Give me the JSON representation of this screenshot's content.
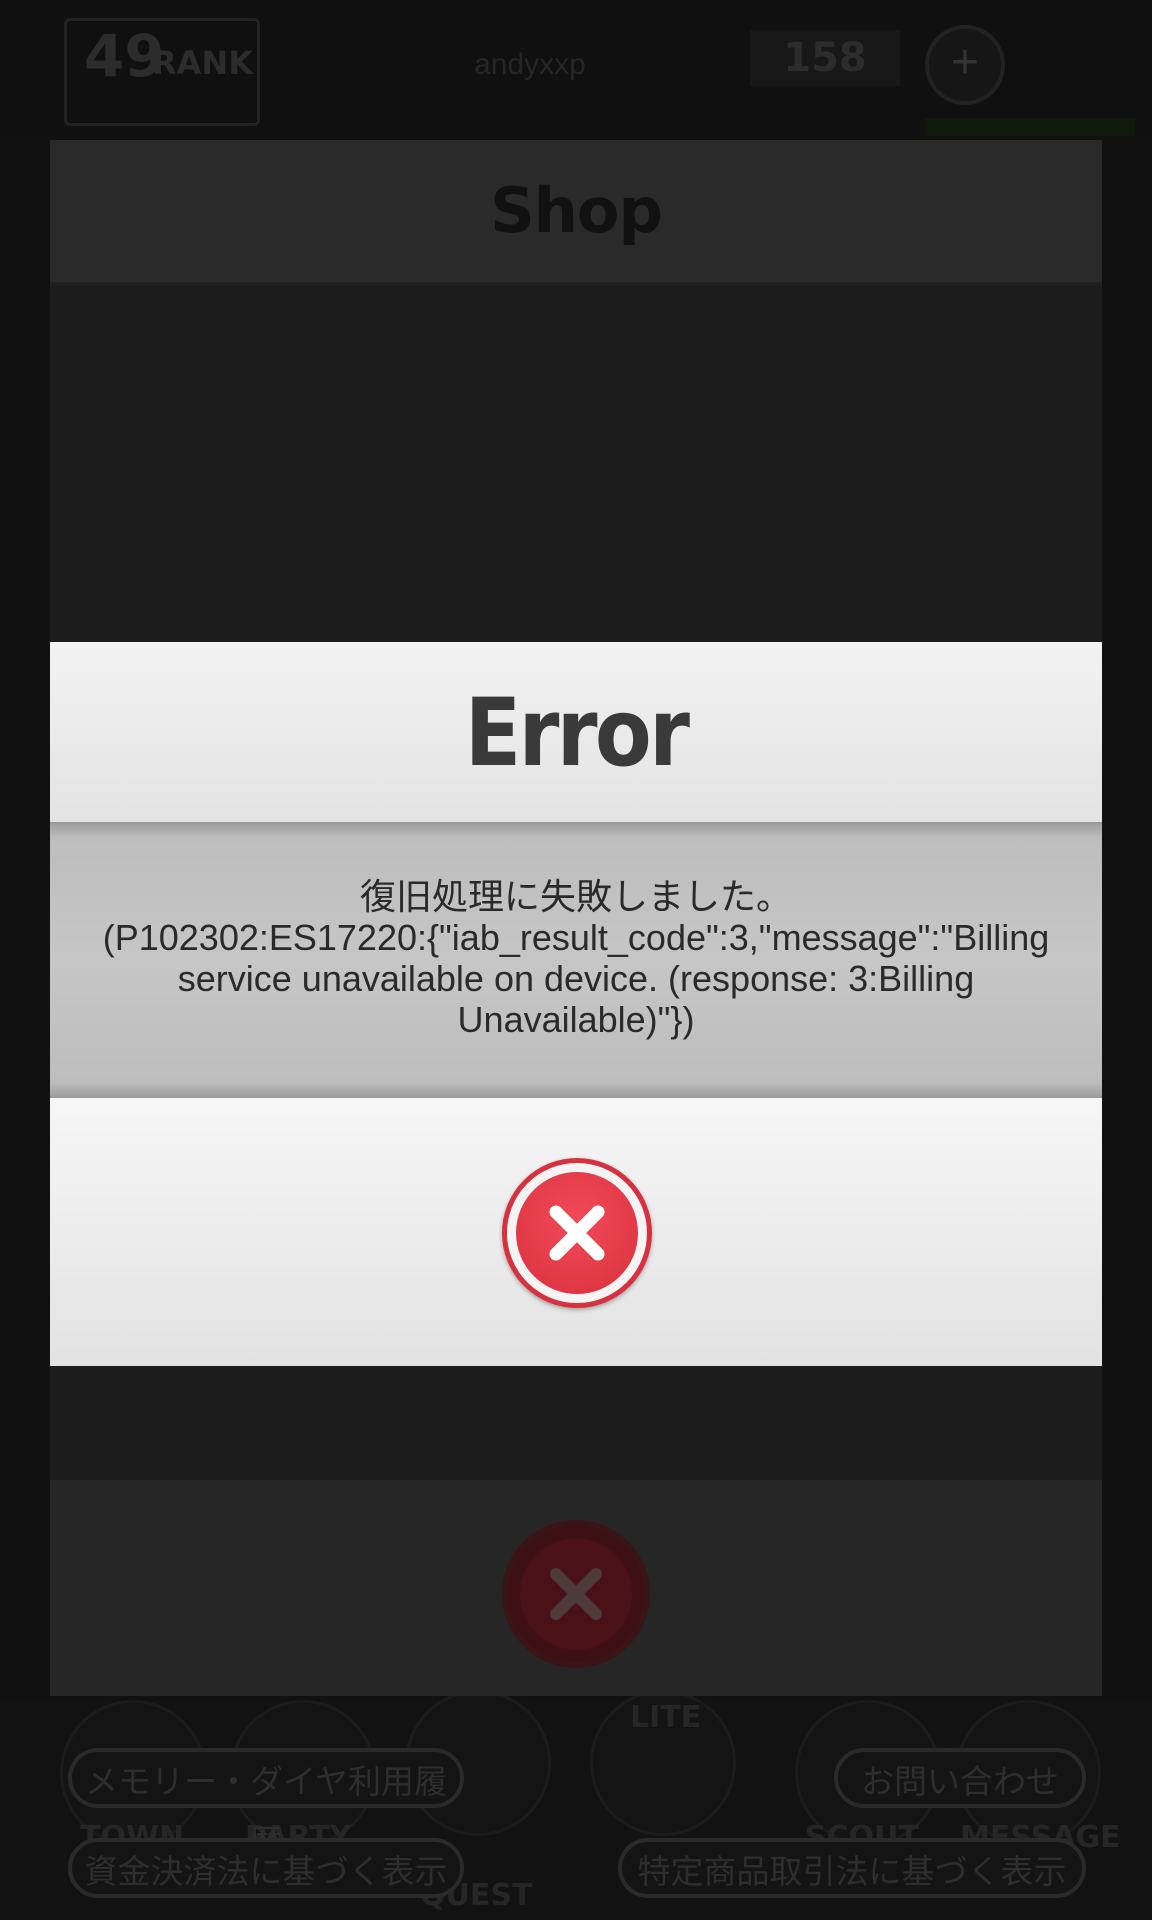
{
  "top_bar": {
    "rank_number": "49",
    "rank_label": "RANK",
    "username": "andyxxp",
    "currency_value": "158",
    "add_symbol": "+"
  },
  "bottom_nav": {
    "labels": [
      "TOWN",
      "PARTY",
      "QUEST",
      "LITE",
      "SCOUT",
      "MESSAGE"
    ]
  },
  "footer_links": {
    "memory_history": "メモリー・ダイヤ利用履歴",
    "contact": "お問い合わせ",
    "payment_law": "資金決済法に基づく表示",
    "commerce_law": "特定商品取引法に基づく表示"
  },
  "shop": {
    "title": "Shop"
  },
  "error_dialog": {
    "title": "Error",
    "message": "復旧処理に失敗しました。\n(P102302:ES17220:{\"iab_result_code\":3,\"message\":\"Billing\nservice unavailable on device. (response: 3:Billing\nUnavailable)\"})",
    "close_icon": "close-x-icon",
    "accent_color": "#d9303e"
  }
}
